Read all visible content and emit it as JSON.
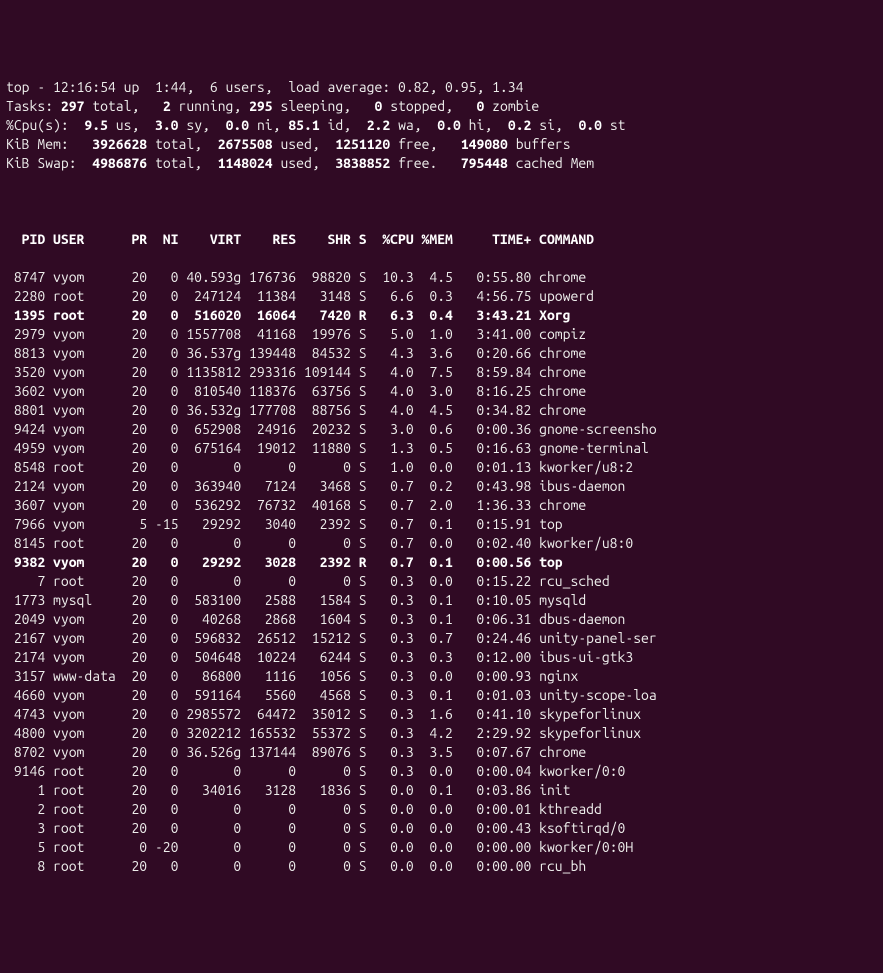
{
  "summary": {
    "line1_pre": "top - ",
    "line1_time": "12:16:54 up  1:44,  6 users,  load average: 0.82, 0.95, 1.34",
    "tasks_label": "Tasks:",
    "tasks_total": " 297 ",
    "tasks_total_lbl": "total,   ",
    "tasks_running": "2 ",
    "tasks_running_lbl": "running, ",
    "tasks_sleeping": "295 ",
    "tasks_sleeping_lbl": "sleeping,   ",
    "tasks_stopped": "0 ",
    "tasks_stopped_lbl": "stopped,   ",
    "tasks_zombie": "0 ",
    "tasks_zombie_lbl": "zombie",
    "cpu_label": "%Cpu(s):  ",
    "cpu_us": "9.5 ",
    "cpu_us_lbl": "us,  ",
    "cpu_sy": "3.0 ",
    "cpu_sy_lbl": "sy,  ",
    "cpu_ni": "0.0 ",
    "cpu_ni_lbl": "ni, ",
    "cpu_id": "85.1 ",
    "cpu_id_lbl": "id,  ",
    "cpu_wa": "2.2 ",
    "cpu_wa_lbl": "wa,  ",
    "cpu_hi": "0.0 ",
    "cpu_hi_lbl": "hi,  ",
    "cpu_si": "0.2 ",
    "cpu_si_lbl": "si,  ",
    "cpu_st": "0.0 ",
    "cpu_st_lbl": "st",
    "mem_label": "KiB Mem:   ",
    "mem_total": "3926628 ",
    "mem_total_lbl": "total,  ",
    "mem_used": "2675508 ",
    "mem_used_lbl": "used,  ",
    "mem_free": "1251120 ",
    "mem_free_lbl": "free,   ",
    "mem_buffers": "149080 ",
    "mem_buffers_lbl": "buffers",
    "swap_label": "KiB Swap:  ",
    "swap_total": "4986876 ",
    "swap_total_lbl": "total,  ",
    "swap_used": "1148024 ",
    "swap_used_lbl": "used,  ",
    "swap_free": "3838852 ",
    "swap_free_lbl": "free.   ",
    "swap_cached": "795448 ",
    "swap_cached_lbl": "cached Mem"
  },
  "columns": "  PID USER      PR  NI    VIRT    RES    SHR S  %CPU %MEM     TIME+ COMMAND            ",
  "processes": [
    {
      "row": " 8747 vyom      20   0 40.593g 176736  98820 S  10.3  4.5   0:55.80 chrome             ",
      "running": false
    },
    {
      "row": " 2280 root      20   0  247124  11384   3148 S   6.6  0.3   4:56.75 upowerd            ",
      "running": false
    },
    {
      "row": " 1395 root      20   0  516020  16064   7420 R   6.3  0.4   3:43.21 Xorg               ",
      "running": true
    },
    {
      "row": " 2979 vyom      20   0 1557708  41168  19976 S   5.0  1.0   3:41.00 compiz             ",
      "running": false
    },
    {
      "row": " 8813 vyom      20   0 36.537g 139448  84532 S   4.3  3.6   0:20.66 chrome             ",
      "running": false
    },
    {
      "row": " 3520 vyom      20   0 1135812 293316 109144 S   4.0  7.5   8:59.84 chrome             ",
      "running": false
    },
    {
      "row": " 3602 vyom      20   0  810540 118376  63756 S   4.0  3.0   8:16.25 chrome             ",
      "running": false
    },
    {
      "row": " 8801 vyom      20   0 36.532g 177708  88756 S   4.0  4.5   0:34.82 chrome             ",
      "running": false
    },
    {
      "row": " 9424 vyom      20   0  652908  24916  20232 S   3.0  0.6   0:00.36 gnome-screensho    ",
      "running": false
    },
    {
      "row": " 4959 vyom      20   0  675164  19012  11880 S   1.3  0.5   0:16.63 gnome-terminal     ",
      "running": false
    },
    {
      "row": " 8548 root      20   0       0      0      0 S   1.0  0.0   0:01.13 kworker/u8:2       ",
      "running": false
    },
    {
      "row": " 2124 vyom      20   0  363940   7124   3468 S   0.7  0.2   0:43.98 ibus-daemon        ",
      "running": false
    },
    {
      "row": " 3607 vyom      20   0  536292  76732  40168 S   0.7  2.0   1:36.33 chrome             ",
      "running": false
    },
    {
      "row": " 7966 vyom       5 -15   29292   3040   2392 S   0.7  0.1   0:15.91 top                ",
      "running": false
    },
    {
      "row": " 8145 root      20   0       0      0      0 S   0.7  0.0   0:02.40 kworker/u8:0       ",
      "running": false
    },
    {
      "row": " 9382 vyom      20   0   29292   3028   2392 R   0.7  0.1   0:00.56 top                ",
      "running": true
    },
    {
      "row": "    7 root      20   0       0      0      0 S   0.3  0.0   0:15.22 rcu_sched          ",
      "running": false
    },
    {
      "row": " 1773 mysql     20   0  583100   2588   1584 S   0.3  0.1   0:10.05 mysqld             ",
      "running": false
    },
    {
      "row": " 2049 vyom      20   0   40268   2868   1604 S   0.3  0.1   0:06.31 dbus-daemon        ",
      "running": false
    },
    {
      "row": " 2167 vyom      20   0  596832  26512  15212 S   0.3  0.7   0:24.46 unity-panel-ser    ",
      "running": false
    },
    {
      "row": " 2174 vyom      20   0  504648  10224   6244 S   0.3  0.3   0:12.00 ibus-ui-gtk3       ",
      "running": false
    },
    {
      "row": " 3157 www-data  20   0   86800   1116   1056 S   0.3  0.0   0:00.93 nginx              ",
      "running": false
    },
    {
      "row": " 4660 vyom      20   0  591164   5560   4568 S   0.3  0.1   0:01.03 unity-scope-loa    ",
      "running": false
    },
    {
      "row": " 4743 vyom      20   0 2985572  64472  35012 S   0.3  1.6   0:41.10 skypeforlinux      ",
      "running": false
    },
    {
      "row": " 4800 vyom      20   0 3202212 165532  55372 S   0.3  4.2   2:29.92 skypeforlinux      ",
      "running": false
    },
    {
      "row": " 8702 vyom      20   0 36.526g 137144  89076 S   0.3  3.5   0:07.67 chrome             ",
      "running": false
    },
    {
      "row": " 9146 root      20   0       0      0      0 S   0.3  0.0   0:00.04 kworker/0:0        ",
      "running": false
    },
    {
      "row": "    1 root      20   0   34016   3128   1836 S   0.0  0.1   0:03.86 init               ",
      "running": false
    },
    {
      "row": "    2 root      20   0       0      0      0 S   0.0  0.0   0:00.01 kthreadd           ",
      "running": false
    },
    {
      "row": "    3 root      20   0       0      0      0 S   0.0  0.0   0:00.43 ksoftirqd/0        ",
      "running": false
    },
    {
      "row": "    5 root       0 -20       0      0      0 S   0.0  0.0   0:00.00 kworker/0:0H       ",
      "running": false
    },
    {
      "row": "    8 root      20   0       0      0      0 S   0.0  0.0   0:00.00 rcu_bh             ",
      "running": false
    }
  ]
}
